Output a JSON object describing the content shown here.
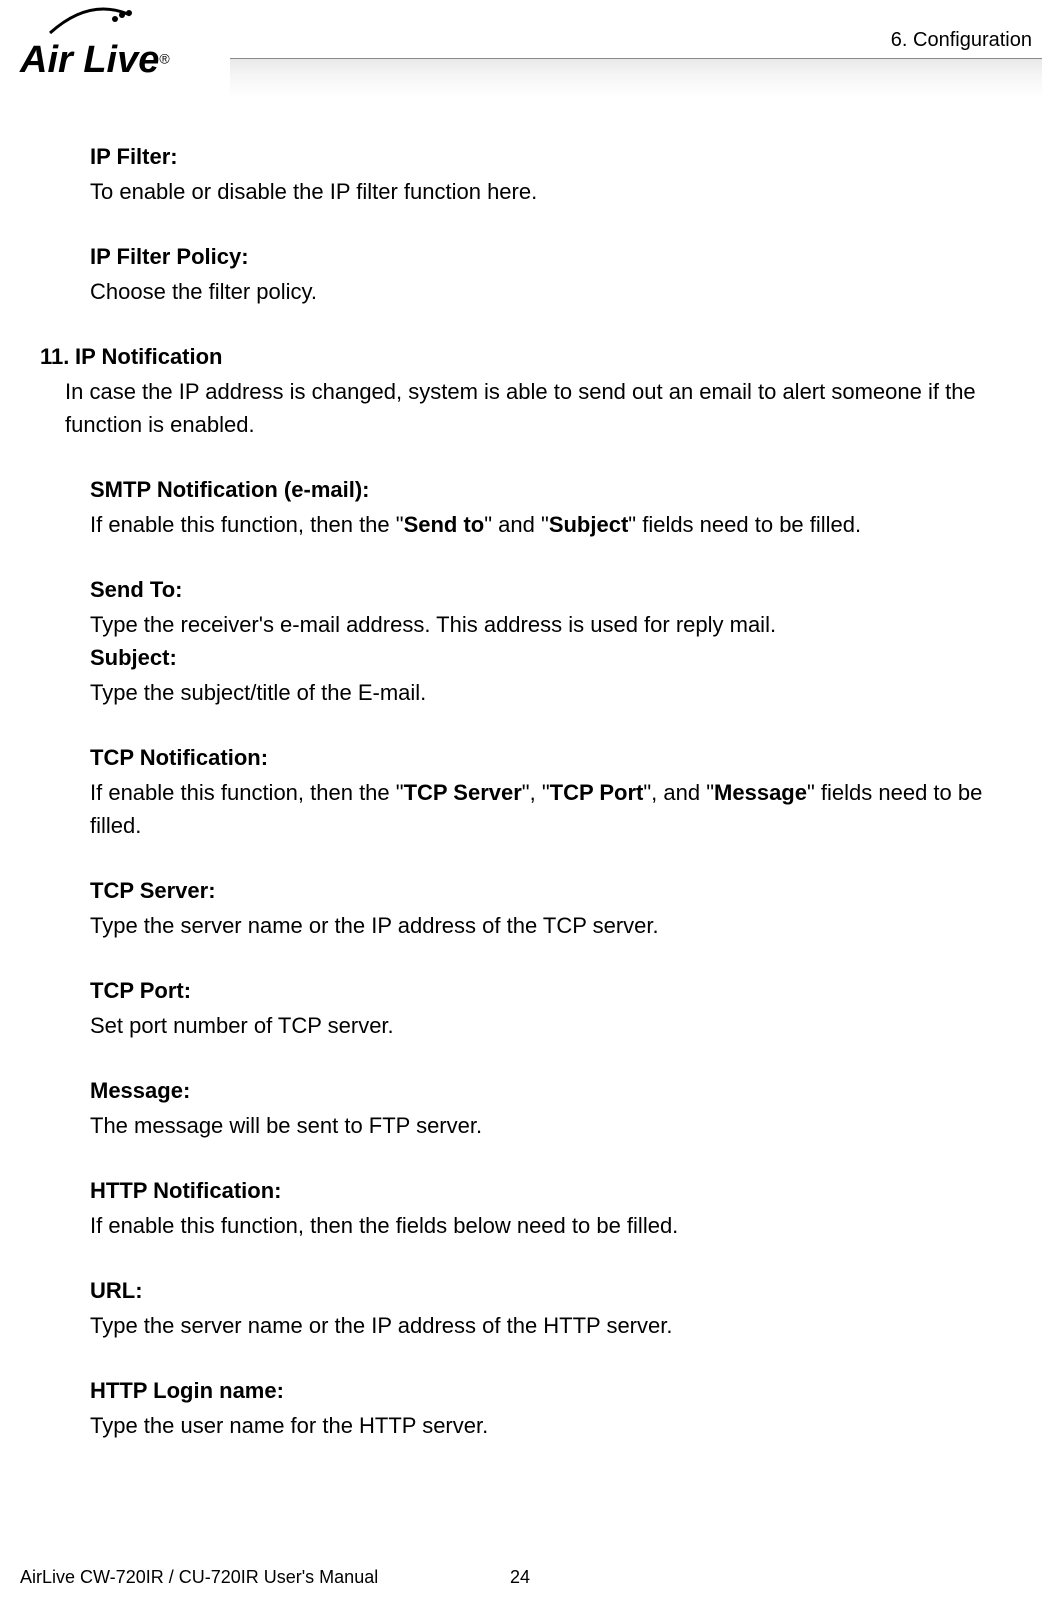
{
  "header": {
    "logo_text": "Air Live",
    "logo_reg": "®",
    "chapter": "6.  Configuration"
  },
  "sections": {
    "ip_filter": {
      "heading": "IP Filter:",
      "text": "To enable or disable the IP filter function here."
    },
    "ip_filter_policy": {
      "heading": "IP Filter Policy:",
      "text": "Choose the filter policy."
    },
    "ip_notification": {
      "number": "11.",
      "heading": "IP Notification",
      "intro": "In case the IP address is changed, system is able to send out an email to alert someone if the function is enabled."
    },
    "smtp": {
      "heading": "SMTP Notification (e-mail):",
      "text_pre": "If enable this function, then the \"",
      "bold1": "Send to",
      "text_mid": "\" and \"",
      "bold2": "Subject",
      "text_post": "\" fields need to be filled."
    },
    "send_to": {
      "heading": "Send To:",
      "text": "Type the receiver's e-mail address. This address is used for reply mail."
    },
    "subject": {
      "heading": "Subject:",
      "text": "Type the subject/title of the E-mail."
    },
    "tcp_notification": {
      "heading": "TCP Notification:",
      "text_pre": "If enable this function, then the \"",
      "bold1": "TCP Server",
      "text_mid1": "\", \"",
      "bold2": "TCP Port",
      "text_mid2": "\", and \"",
      "bold3": "Message",
      "text_post": "\" fields need to be filled."
    },
    "tcp_server": {
      "heading": "TCP Server:",
      "text": "Type the server name or the IP address of the TCP server."
    },
    "tcp_port": {
      "heading": "TCP Port:",
      "text": "Set port number of TCP server."
    },
    "message": {
      "heading": "Message:",
      "text": "The message will be sent to FTP server."
    },
    "http_notification": {
      "heading": "HTTP Notification:",
      "text": "If enable this function, then the fields below need to be filled."
    },
    "url": {
      "heading": "URL:",
      "text": "Type the server name or the IP address of the HTTP server."
    },
    "http_login": {
      "heading": "HTTP Login name:",
      "text": "Type the user name for the HTTP server."
    }
  },
  "footer": {
    "title": "AirLive CW-720IR / CU-720IR User's Manual",
    "page": "24"
  }
}
